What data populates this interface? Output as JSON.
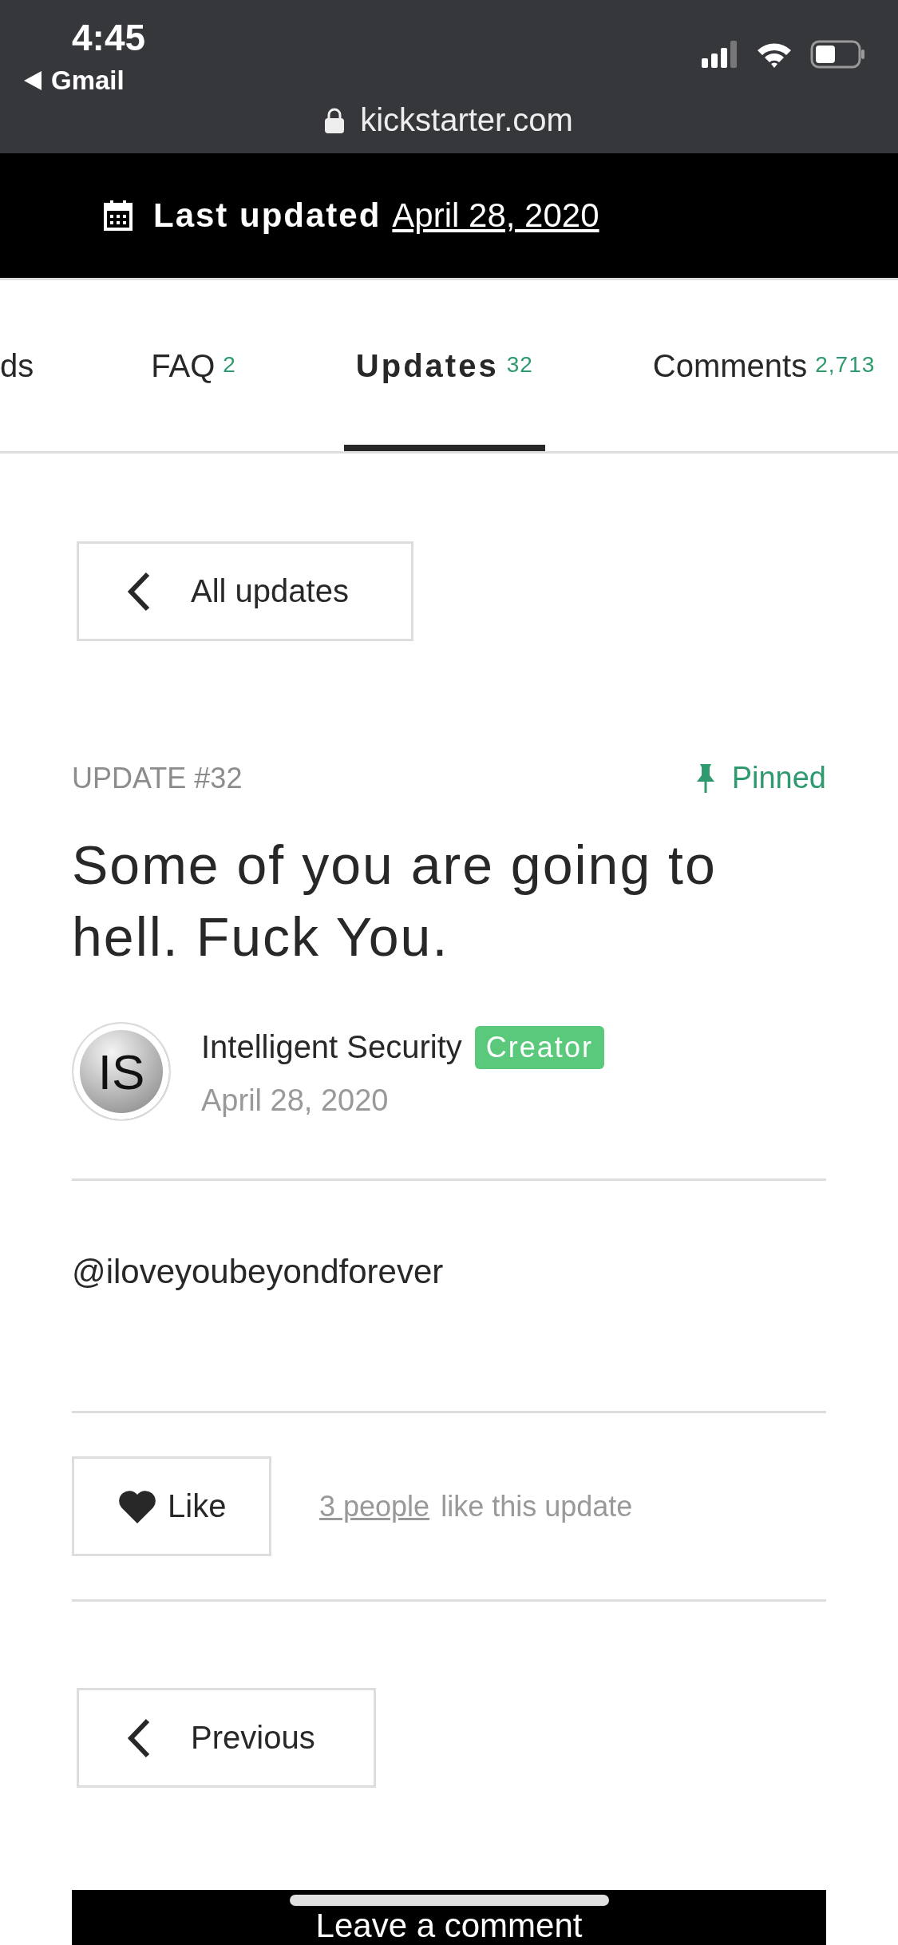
{
  "browser": {
    "time": "4:45",
    "back_app": "Gmail",
    "url": "kickstarter.com"
  },
  "project_header": {
    "label": "Last updated",
    "date": "April 28, 2020"
  },
  "tabs": [
    {
      "label": "ds",
      "selected": false
    },
    {
      "label": "FAQ",
      "count": "2",
      "selected": false
    },
    {
      "label": "Updates",
      "count": "32",
      "selected": true
    },
    {
      "label": "Comments",
      "count": "2,713",
      "selected": false
    }
  ],
  "back_button": "All updates",
  "update": {
    "number": "UPDATE #32",
    "pinned": true,
    "pinned_label": "Pinned",
    "title": "Some of you are going to hell. Fuck You.",
    "author": {
      "name": "Intelligent Security",
      "initials": "IS",
      "badge": "Creator"
    },
    "date": "April 28, 2020",
    "body": "@iloveyoubeyondforever",
    "like_button": "Like",
    "likes_link": "3 people",
    "likes_text": "like this update"
  },
  "previous_button": "Previous",
  "comment_button": "Leave a comment"
}
